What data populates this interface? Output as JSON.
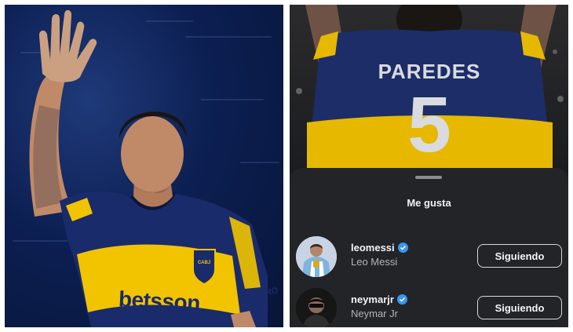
{
  "left_photo": {
    "sponsor_text": "betsson",
    "sleeve_text": "CETRO",
    "badge_text": "CABJ"
  },
  "right_photo": {
    "jersey_name": "PAREDES",
    "jersey_number": "5"
  },
  "likes_sheet": {
    "title": "Me gusta",
    "users": [
      {
        "username": "leomessi",
        "name": "Leo Messi",
        "verified": true,
        "button": "Siguiendo"
      },
      {
        "username": "neymarjr",
        "name": "Neymar Jr",
        "verified": true,
        "button": "Siguiendo"
      }
    ]
  },
  "colors": {
    "boca_blue": "#1a2b6b",
    "boca_gold": "#f2c400",
    "verified_blue": "#3897f0",
    "sheet_bg": "#232428"
  }
}
